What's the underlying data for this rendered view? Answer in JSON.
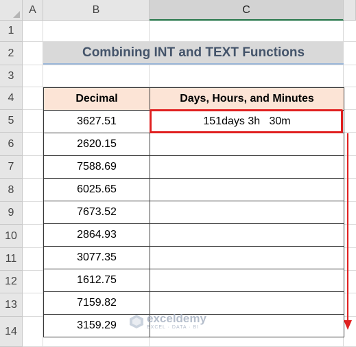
{
  "columns": [
    "A",
    "B",
    "C"
  ],
  "rows": [
    "1",
    "2",
    "3",
    "4",
    "5",
    "6",
    "7",
    "8",
    "9",
    "10",
    "11",
    "12",
    "13",
    "14"
  ],
  "title": "Combining INT and TEXT Functions",
  "table": {
    "headers": [
      "Decimal",
      "Days, Hours, and Minutes"
    ],
    "rows": [
      {
        "decimal": "3627.51",
        "result": "151days 3h   30m"
      },
      {
        "decimal": "2620.15",
        "result": ""
      },
      {
        "decimal": "7588.69",
        "result": ""
      },
      {
        "decimal": "6025.65",
        "result": ""
      },
      {
        "decimal": "7673.52",
        "result": ""
      },
      {
        "decimal": "2864.93",
        "result": ""
      },
      {
        "decimal": "3077.35",
        "result": ""
      },
      {
        "decimal": "1612.75",
        "result": ""
      },
      {
        "decimal": "7159.82",
        "result": ""
      },
      {
        "decimal": "3159.29",
        "result": ""
      }
    ]
  },
  "watermark": {
    "name": "exceldemy",
    "tagline": "EXCEL · DATA · BI"
  },
  "colors": {
    "accent": "#e02020",
    "header_fill": "#fce4d6",
    "title_fill": "#d9d9d9"
  }
}
